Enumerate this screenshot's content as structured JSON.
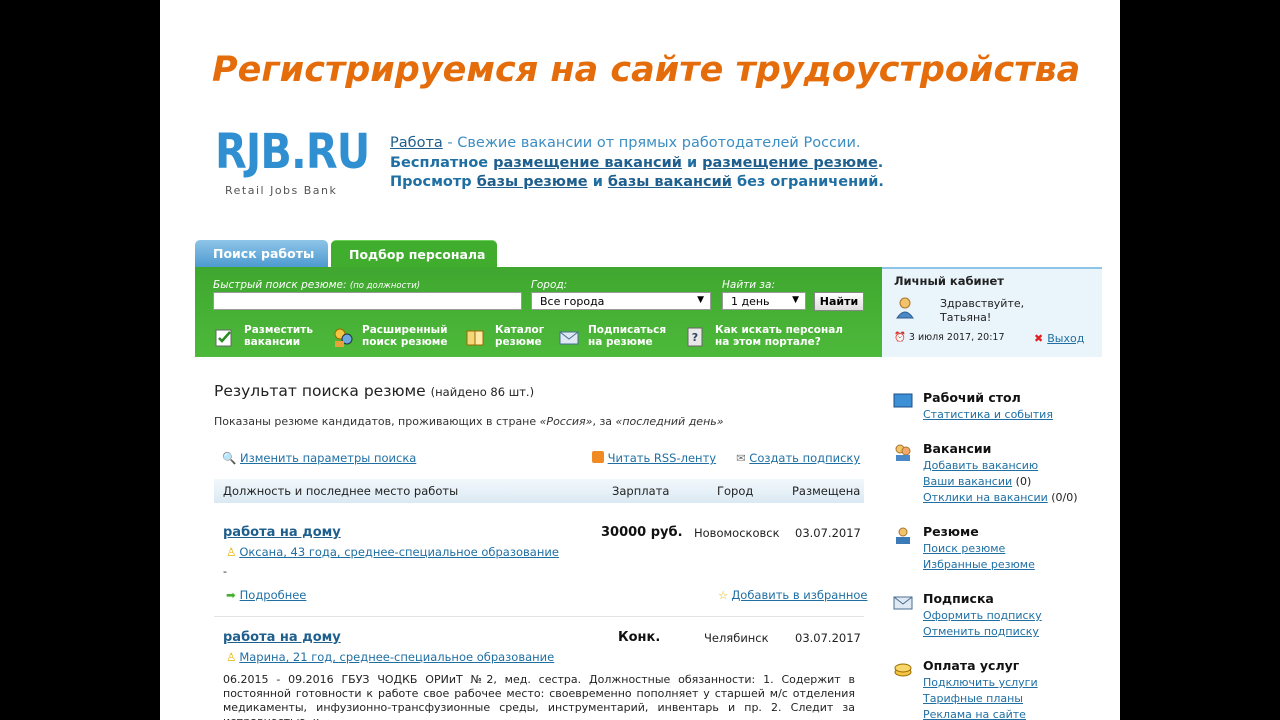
{
  "slide": {
    "title": "Регистрируемся на сайте трудоустройства"
  },
  "header": {
    "logo_text": "RJB.RU",
    "logo_subtext": "Retail Jobs Bank",
    "line1": {
      "link": "Работа",
      "rest": " - Свежие вакансии от прямых работодателей России."
    },
    "line2": {
      "a": "Бесплатное ",
      "link1": "размещение вакансий",
      "b": " и ",
      "link2": "размещение резюме",
      "c": "."
    },
    "line3": {
      "a": "Просмотр ",
      "link1": "базы резюме",
      "b": " и ",
      "link2": "базы вакансий",
      "c": " без ограничений."
    }
  },
  "tabs": {
    "search": "Поиск работы",
    "hire": "Подбор персонала"
  },
  "quick_search": {
    "label": "Быстрый поиск резюме:",
    "label_hint": "(по должности)",
    "value": "",
    "city_label": "Город:",
    "city_value": "Все города",
    "period_label": "Найти за:",
    "period_value": "1 день",
    "find_button": "Найти"
  },
  "actions": [
    {
      "line1": "Разместить",
      "line2": "вакансии",
      "icon": "post-vacancy-icon"
    },
    {
      "line1": "Расширенный",
      "line2": "поиск резюме",
      "icon": "advanced-search-icon"
    },
    {
      "line1": "Каталог",
      "line2": "резюме",
      "icon": "catalog-icon"
    },
    {
      "line1": "Подписаться",
      "line2": "на резюме",
      "icon": "subscribe-icon"
    },
    {
      "line1": "Как искать персонал",
      "line2": "на этом портале?",
      "icon": "help-icon"
    }
  ],
  "cabinet": {
    "title": "Личный кабинет",
    "greeting1": "Здравствуйте,",
    "greeting2": "Татьяна!",
    "date": "3 июля 2017, 20:17",
    "exit": "Выход"
  },
  "results": {
    "title": "Результат поиска резюме",
    "count": "(найдено 86 шт.)",
    "subtitle_a": "Показаны резюме кандидатов, проживающих в стране ",
    "subtitle_country": "«Россия»",
    "subtitle_b": ", за ",
    "subtitle_period": "«последний день»",
    "change_params": "Изменить параметры поиска",
    "rss": "Читать RSS-ленту",
    "create_sub": "Создать подписку",
    "columns": {
      "position": "Должность и последнее место работы",
      "salary": "Зарплата",
      "city": "Город",
      "date": "Размещена"
    },
    "rows": [
      {
        "position": "работа на дому",
        "salary": "30000 руб.",
        "city": "Новомосковск",
        "date": "03.07.2017",
        "candidate": "Оксана, 43 года, среднее-специальное образование",
        "description": "-",
        "more": "Подробнее",
        "favorite": "Добавить в избранное"
      },
      {
        "position": "работа на дому",
        "salary": "Конк.",
        "city": "Челябинск",
        "date": "03.07.2017",
        "candidate": "Марина, 21 год, среднее-специальное образование",
        "description": "06.2015 - 09.2016 ГБУЗ ЧОДКБ ОРИиТ №2, мед. сестра. Должностные обязанности: 1. Содержит в постоянной готовности к работе свое рабочее место: своевременно пополняет у старшей м/с отделения медикаменты, инфузионно-трансфузионные среды, инструментарий, инвентарь и пр. 2. Следит за исправностью, к..."
      }
    ]
  },
  "sidebar": {
    "desk": {
      "title": "Рабочий стол",
      "links": [
        "Статистика и события"
      ]
    },
    "vacancies": {
      "title": "Вакансии",
      "links": [
        "Добавить вакансию",
        "Ваши вакансии",
        "Отклики на вакансии"
      ],
      "counts": [
        "",
        "(0)",
        "(0/0)"
      ]
    },
    "resume": {
      "title": "Резюме",
      "links": [
        "Поиск резюме",
        "Избранные резюме"
      ]
    },
    "subscription": {
      "title": "Подписка",
      "links": [
        "Оформить подписку",
        "Отменить подписку"
      ]
    },
    "services": {
      "title": "Оплата услуг",
      "links": [
        "Подключить услуги",
        "Тарифные планы",
        "Реклама на сайте"
      ]
    }
  }
}
